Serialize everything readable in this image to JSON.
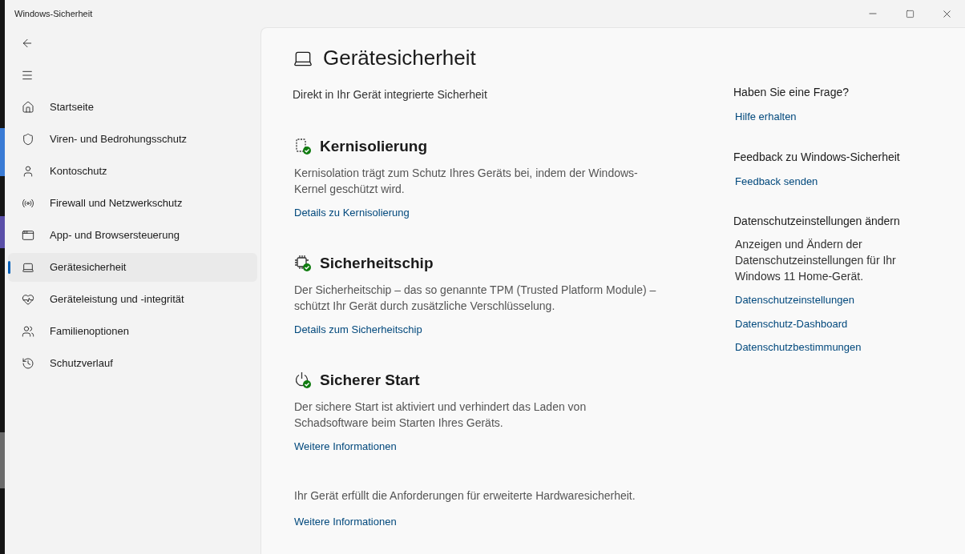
{
  "window": {
    "title": "Windows-Sicherheit"
  },
  "sidebar": {
    "items": [
      {
        "kind": "home",
        "label": "Startseite",
        "selected": false
      },
      {
        "kind": "shield",
        "label": "Viren- und Bedrohungsschutz",
        "selected": false
      },
      {
        "kind": "person",
        "label": "Kontoschutz",
        "selected": false
      },
      {
        "kind": "antenna",
        "label": "Firewall und Netzwerkschutz",
        "selected": false
      },
      {
        "kind": "window",
        "label": "App- und Browsersteuerung",
        "selected": false
      },
      {
        "kind": "laptop",
        "label": "Gerätesicherheit",
        "selected": true
      },
      {
        "kind": "heart",
        "label": "Geräteleistung und -integrität",
        "selected": false
      },
      {
        "kind": "family",
        "label": "Familienoptionen",
        "selected": false
      },
      {
        "kind": "history",
        "label": "Schutzverlauf",
        "selected": false
      }
    ]
  },
  "page": {
    "title": "Gerätesicherheit",
    "subtitle": "Direkt in Ihr Gerät integrierte Sicherheit",
    "sections": [
      {
        "kind": "core",
        "title": "Kernisolierung",
        "text": "Kernisolation trägt zum Schutz Ihres Geräts bei, indem der Windows-Kernel geschützt wird.",
        "link": "Details zu Kernisolierung"
      },
      {
        "kind": "chip",
        "title": "Sicherheitschip",
        "text": "Der Sicherheitschip – das so genannte TPM (Trusted Platform Module) – schützt Ihr Gerät durch zusätzliche Verschlüsselung.",
        "link": "Details zum Sicherheitschip"
      },
      {
        "kind": "power",
        "title": "Sicherer Start",
        "text": "Der sichere Start ist aktiviert und verhindert das Laden von Schadsoftware beim Starten Ihres Geräts.",
        "link": "Weitere Informationen"
      }
    ],
    "footer": {
      "text": "Ihr Gerät erfüllt die Anforderungen für erweiterte Hardwaresicherheit.",
      "link": "Weitere Informationen"
    }
  },
  "aside": [
    {
      "title": "Haben Sie eine Frage?",
      "links": [
        "Hilfe erhalten"
      ]
    },
    {
      "title": "Feedback zu Windows-Sicherheit",
      "links": [
        "Feedback senden"
      ]
    },
    {
      "title": "Datenschutzeinstellungen ändern",
      "text": "Anzeigen und Ändern der Datenschutzeinstellungen für Ihr Windows 11 Home-Gerät.",
      "links": [
        "Datenschutzeinstellungen",
        "Datenschutz-Dashboard",
        "Datenschutzbestimmungen"
      ]
    }
  ]
}
